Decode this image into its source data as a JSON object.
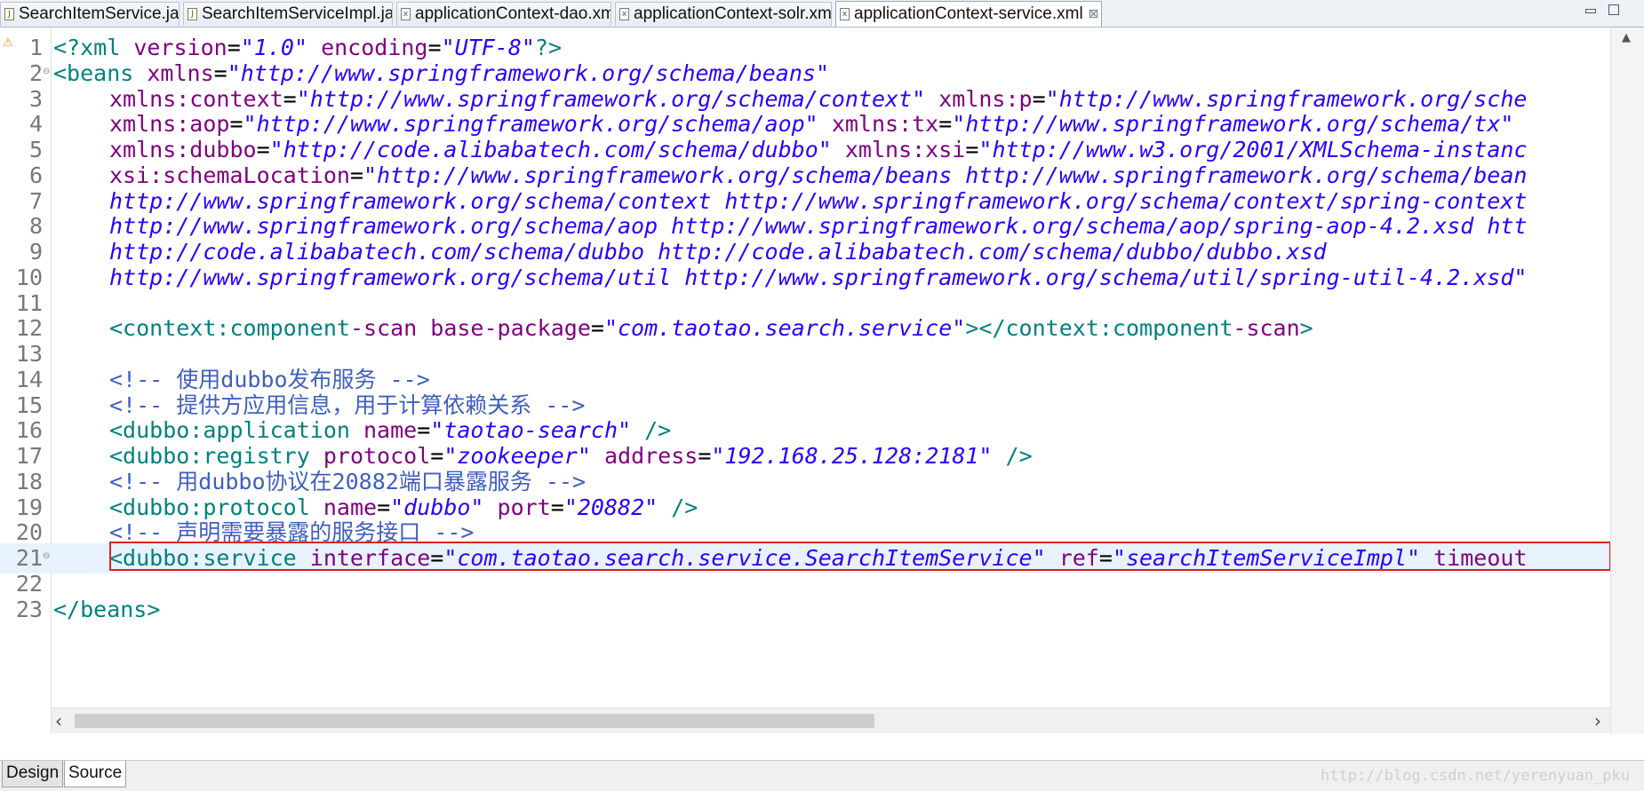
{
  "tabs": [
    {
      "label": "SearchItemService.java",
      "icon": "java-file-icon",
      "active": false
    },
    {
      "label": "SearchItemServiceImpl.java",
      "icon": "java-file-icon",
      "active": false
    },
    {
      "label": "applicationContext-dao.xml",
      "icon": "xml-file-icon",
      "active": false
    },
    {
      "label": "applicationContext-solr.xml",
      "icon": "xml-file-icon",
      "active": false
    },
    {
      "label": "applicationContext-service.xml",
      "icon": "xml-file-icon",
      "active": true
    }
  ],
  "close_glyph": "⊠",
  "editor": {
    "current_line": 21,
    "lines": [
      {
        "n": "1",
        "code": "<?xml version=\"1.0\" encoding=\"UTF-8\"?>"
      },
      {
        "n": "2",
        "code": "<beans xmlns=\"http://www.springframework.org/schema/beans\""
      },
      {
        "n": "3",
        "code": "    xmlns:context=\"http://www.springframework.org/schema/context\" xmlns:p=\"http://www.springframework.org/sche"
      },
      {
        "n": "4",
        "code": "    xmlns:aop=\"http://www.springframework.org/schema/aop\" xmlns:tx=\"http://www.springframework.org/schema/tx\""
      },
      {
        "n": "5",
        "code": "    xmlns:dubbo=\"http://code.alibabatech.com/schema/dubbo\" xmlns:xsi=\"http://www.w3.org/2001/XMLSchema-instanc"
      },
      {
        "n": "6",
        "code": "    xsi:schemaLocation=\"http://www.springframework.org/schema/beans http://www.springframework.org/schema/bean"
      },
      {
        "n": "7",
        "code": "    http://www.springframework.org/schema/context http://www.springframework.org/schema/context/spring-context"
      },
      {
        "n": "8",
        "code": "    http://www.springframework.org/schema/aop http://www.springframework.org/schema/aop/spring-aop-4.2.xsd htt"
      },
      {
        "n": "9",
        "code": "    http://code.alibabatech.com/schema/dubbo http://code.alibabatech.com/schema/dubbo/dubbo.xsd"
      },
      {
        "n": "10",
        "code": "    http://www.springframework.org/schema/util http://www.springframework.org/schema/util/spring-util-4.2.xsd\""
      },
      {
        "n": "11",
        "code": ""
      },
      {
        "n": "12",
        "code": "    <context:component-scan base-package=\"com.taotao.search.service\"></context:component-scan>"
      },
      {
        "n": "13",
        "code": ""
      },
      {
        "n": "14",
        "code": "    <!-- 使用dubbo发布服务 -->"
      },
      {
        "n": "15",
        "code": "    <!-- 提供方应用信息，用于计算依赖关系 -->"
      },
      {
        "n": "16",
        "code": "    <dubbo:application name=\"taotao-search\" />"
      },
      {
        "n": "17",
        "code": "    <dubbo:registry protocol=\"zookeeper\" address=\"192.168.25.128:2181\" />"
      },
      {
        "n": "18",
        "code": "    <!-- 用dubbo协议在20882端口暴露服务 -->"
      },
      {
        "n": "19",
        "code": "    <dubbo:protocol name=\"dubbo\" port=\"20882\" />"
      },
      {
        "n": "20",
        "code": "    <!-- 声明需要暴露的服务接口 -->"
      },
      {
        "n": "21",
        "code": "    <dubbo:service interface=\"com.taotao.search.service.SearchItemService\" ref=\"searchItemServiceImpl\" timeout"
      },
      {
        "n": "22",
        "code": ""
      },
      {
        "n": "23",
        "code": "</beans>"
      }
    ],
    "foldable_lines": [
      "2",
      "21"
    ]
  },
  "bottom_tabs": [
    {
      "label": "Design",
      "active": false
    },
    {
      "label": "Source",
      "active": true
    }
  ],
  "watermark": "http://blog.csdn.net/yerenyuan_pku",
  "icons": {
    "warning": "warning-icon",
    "fold": "fold-toggle-icon"
  }
}
